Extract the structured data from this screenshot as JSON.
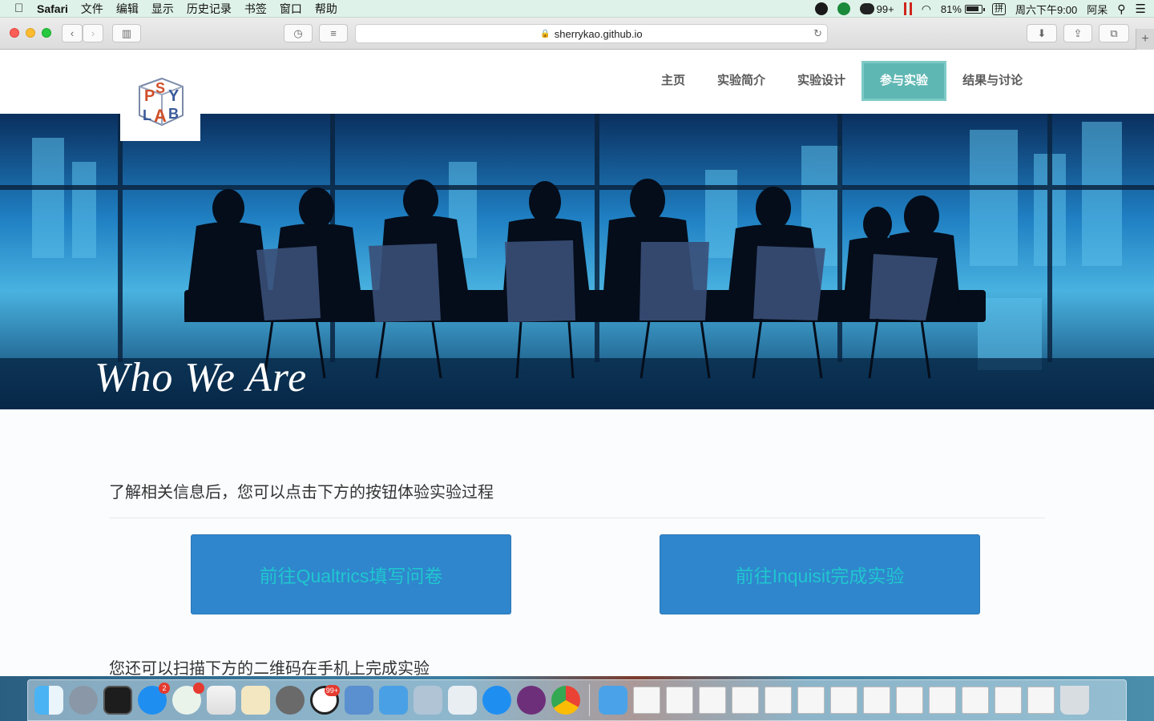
{
  "menubar": {
    "app_name": "Safari",
    "items": [
      "文件",
      "编辑",
      "显示",
      "历史记录",
      "书签",
      "窗口",
      "帮助"
    ],
    "wechat_count": "99+",
    "battery": "81%",
    "input_method": "拼",
    "clock": "周六下午9:00",
    "user": "阿呆"
  },
  "browser": {
    "url": "sherrykao.github.io"
  },
  "site": {
    "logo_text": "PSY LAB",
    "nav": [
      {
        "label": "主页"
      },
      {
        "label": "实验简介"
      },
      {
        "label": "实验设计"
      },
      {
        "label": "参与实验"
      },
      {
        "label": "结果与讨论"
      }
    ],
    "hero_title": "Who We Are",
    "intro": "了解相关信息后，您可以点击下方的按钮体验实验过程",
    "buttons": {
      "qualtrics": "前往Qualtrics填写问卷",
      "inquisit": "前往Inquisit完成实验"
    },
    "qr_text": "您还可以扫描下方的二维码在手机上完成实验"
  },
  "dock": {
    "appstore_badge": "2",
    "qq_badge": "99+"
  },
  "colors": {
    "nav_active": "#5fb7b3",
    "button_bg": "#2f86cc",
    "button_text": "#20c6cf"
  }
}
